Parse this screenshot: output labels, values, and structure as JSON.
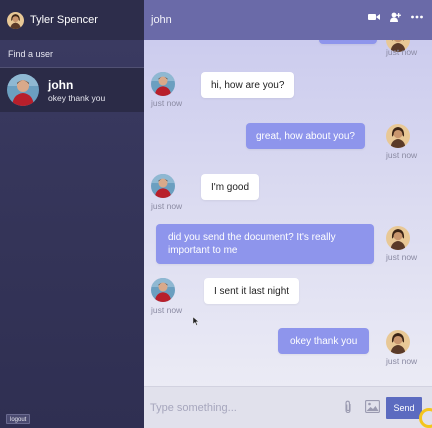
{
  "current_user": {
    "name": "Tyler Spencer"
  },
  "sidebar": {
    "find_user": "Find a user",
    "contacts": [
      {
        "name": "john",
        "last_message": "okey thank you"
      }
    ],
    "logout_label": "logout"
  },
  "chat": {
    "title": "john",
    "icons": [
      "video-camera-icon",
      "add-user-icon",
      "more-icon"
    ],
    "messages": [
      {
        "side": "outgoing",
        "text": "",
        "time": "just now"
      },
      {
        "side": "incoming",
        "text": "hi, how are you?",
        "time": "just now"
      },
      {
        "side": "outgoing",
        "text": "great, how about you?",
        "time": "just now"
      },
      {
        "side": "incoming",
        "text": "I'm good",
        "time": "just now"
      },
      {
        "side": "outgoing",
        "text": "did you send the document? It's really important to me",
        "time": "just now"
      },
      {
        "side": "incoming",
        "text": "I sent it last night",
        "time": "just now"
      },
      {
        "side": "outgoing",
        "text": "okey thank you",
        "time": "just now"
      }
    ]
  },
  "composer": {
    "placeholder": "Type something...",
    "value": "",
    "send_label": "Send",
    "icons": [
      "paperclip-icon",
      "image-icon"
    ]
  },
  "colors": {
    "sidebar_bg": "#3b3b63",
    "topbar_bg": "#6a6aa8",
    "outgoing_bubble": "#8e95ec",
    "incoming_bubble": "#ffffff",
    "send_button": "#5c6bc0"
  }
}
